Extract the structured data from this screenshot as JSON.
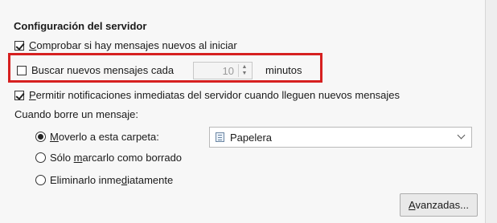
{
  "section_title": "Configuración del servidor",
  "check_on_start": {
    "label_pre": "",
    "label_key": "C",
    "label_post": "omprobar si hay mensajes nuevos al iniciar",
    "checked": true
  },
  "check_every": {
    "label": "Buscar nuevos mensajes cada",
    "checked": false,
    "value": "10",
    "unit": "minutos"
  },
  "push_notifications": {
    "label_pre": "",
    "label_key": "P",
    "label_post": "ermitir notificaciones inmediatas del servidor cuando lleguen nuevos mensajes",
    "checked": true
  },
  "delete_heading": "Cuando borre un mensaje:",
  "radios": [
    {
      "label_pre": "",
      "label_key": "M",
      "label_post": "overlo a esta carpeta:",
      "selected": true
    },
    {
      "label_pre": "Sólo ",
      "label_key": "m",
      "label_post": "arcarlo como borrado",
      "selected": false
    },
    {
      "label_pre": "Eliminarlo inme",
      "label_key": "d",
      "label_post": "iatamente",
      "selected": false
    }
  ],
  "folder_select": {
    "value": "Papelera",
    "icon": "folder-trash-icon"
  },
  "advanced_button": {
    "label_pre": "",
    "label_key": "A",
    "label_post": "vanzadas..."
  },
  "colors": {
    "highlight": "#d62020",
    "background": "#f7f7f7"
  }
}
